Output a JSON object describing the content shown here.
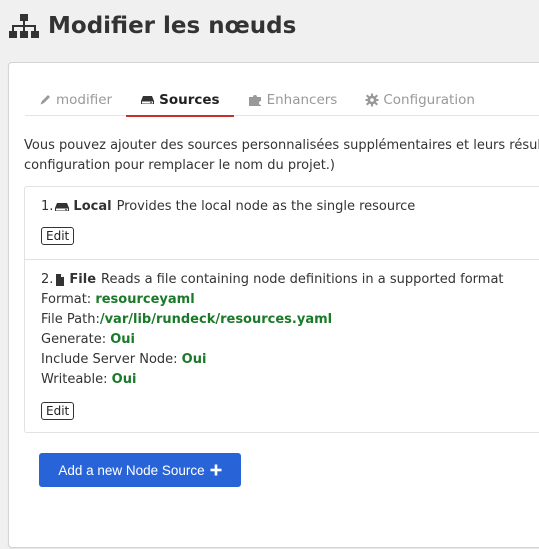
{
  "header": {
    "title": "Modifier les nœuds",
    "icon": "sitemap-icon"
  },
  "tabs": [
    {
      "label": "modifier",
      "icon": "pencil-icon",
      "active": false
    },
    {
      "label": "Sources",
      "icon": "hdd-icon",
      "active": true
    },
    {
      "label": "Enhancers",
      "icon": "puzzle-icon",
      "active": false
    },
    {
      "label": "Configuration",
      "icon": "gear-icon",
      "active": false
    }
  ],
  "description": {
    "line1": "Vous pouvez ajouter des sources personnalisées supplémentaires et leurs résulta",
    "line2": "configuration pour remplacer le nom du projet.)"
  },
  "sources": [
    {
      "index": "1.",
      "icon": "hdd-icon",
      "title": "Local",
      "description": "Provides the local node as the single resource",
      "edit_label": "Edit"
    },
    {
      "index": "2.",
      "icon": "file-icon",
      "title": "File",
      "description": "Reads a file containing node definitions in a supported format",
      "properties": [
        {
          "label": "Format: ",
          "value": "resourceyaml"
        },
        {
          "label": "File Path:",
          "value": "/var/lib/rundeck/resources.yaml"
        },
        {
          "label": "Generate: ",
          "value": "Oui"
        },
        {
          "label": "Include Server Node: ",
          "value": "Oui"
        },
        {
          "label": "Writeable: ",
          "value": "Oui"
        }
      ],
      "edit_label": "Edit"
    }
  ],
  "add_button": {
    "label": "Add a new Node Source",
    "icon": "plus-icon"
  },
  "colors": {
    "accent_tab": "#c9302c",
    "primary_button": "#2864d8",
    "value_green": "#1b7a2a"
  }
}
